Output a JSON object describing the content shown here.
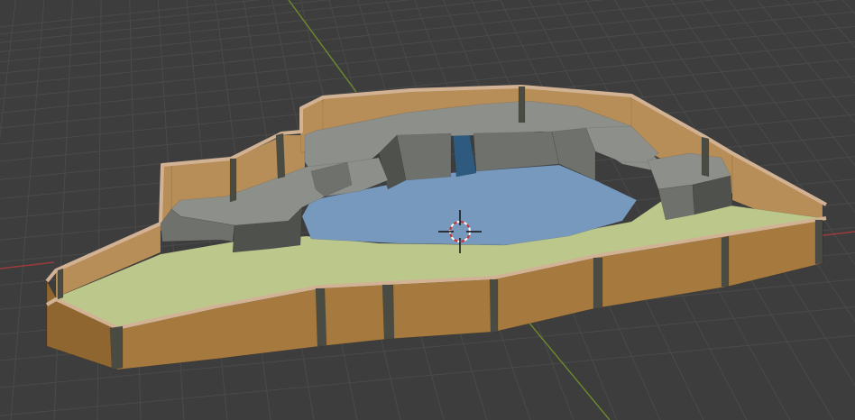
{
  "viewport": {
    "background": "#3d3d3d",
    "grid_color": "#4a4a4a",
    "axis_x_color": "#9a3c3c",
    "axis_y_color": "#6d8a2c"
  },
  "scene": {
    "colors": {
      "wall_front": "#a67a3f",
      "wall_back": "#b88e58",
      "wall_top": "#d2b294",
      "post": "#4a4c44",
      "ground": "#bcc78c",
      "water": "#7899be",
      "rock_light": "#8d8f8b",
      "rock_mid": "#6f716c",
      "rock_dark": "#4f514d",
      "waterfall": "#2e5a80"
    },
    "cursor_icon": "3d-cursor-icon"
  }
}
